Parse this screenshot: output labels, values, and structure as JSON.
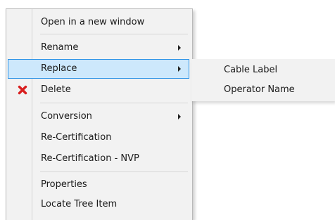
{
  "context_menu": {
    "items": [
      {
        "label": "Open in a new window"
      },
      {
        "label": "Rename"
      },
      {
        "label": "Replace"
      },
      {
        "label": "Delete"
      },
      {
        "label": "Conversion"
      },
      {
        "label": "Re-Certification"
      },
      {
        "label": "Re-Certification - NVP"
      },
      {
        "label": "Properties"
      },
      {
        "label": "Locate Tree Item"
      }
    ]
  },
  "submenu": {
    "items": [
      {
        "label": "Cable Label"
      },
      {
        "label": "Operator Name"
      }
    ]
  },
  "colors": {
    "menu_background": "#f2f2f2",
    "highlight_fill": "#cde8fc",
    "highlight_border": "#2e93e6",
    "delete_icon": "#d81e1e"
  },
  "icons": {
    "delete": "red-x-icon",
    "submenu_arrow": "chevron-right-icon"
  }
}
